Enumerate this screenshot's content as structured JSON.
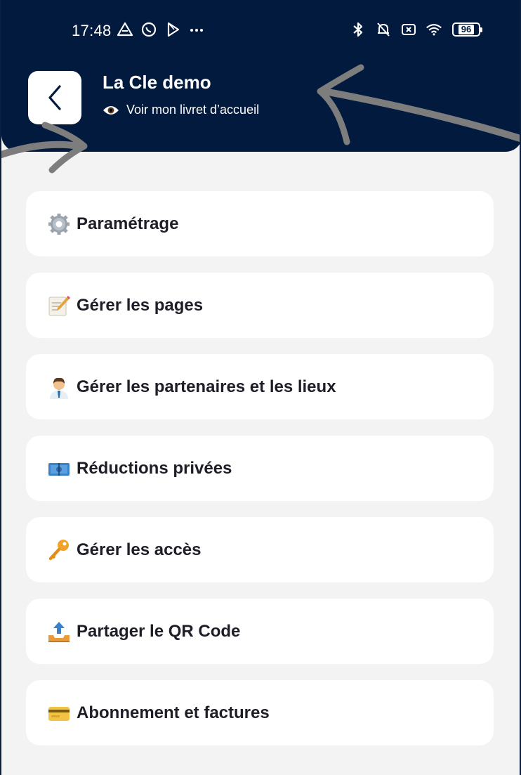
{
  "status_bar": {
    "time": "17:48",
    "battery": "96",
    "icons_left": [
      "drive-icon",
      "whatsapp-icon",
      "play-icon",
      "more-dots-icon"
    ],
    "icons_right": [
      "bluetooth-icon",
      "bell-off-icon",
      "sim-off-icon",
      "wifi-icon",
      "battery-icon"
    ]
  },
  "header": {
    "title": "La Cle demo",
    "subtitle": "Voir mon livret d’accueil",
    "background_color": "#021a3d"
  },
  "menu": {
    "items": [
      {
        "label": "Paramétrage",
        "icon": "gear-icon"
      },
      {
        "label": "Gérer les pages",
        "icon": "memo-icon"
      },
      {
        "label": "Gérer les partenaires et les lieux",
        "icon": "office-worker-icon"
      },
      {
        "label": "Réductions privées",
        "icon": "banknote-icon"
      },
      {
        "label": "Gérer les accès",
        "icon": "key-icon"
      },
      {
        "label": "Partager le QR Code",
        "icon": "outbox-tray-icon"
      },
      {
        "label": "Abonnement et factures",
        "icon": "credit-card-icon"
      }
    ]
  }
}
